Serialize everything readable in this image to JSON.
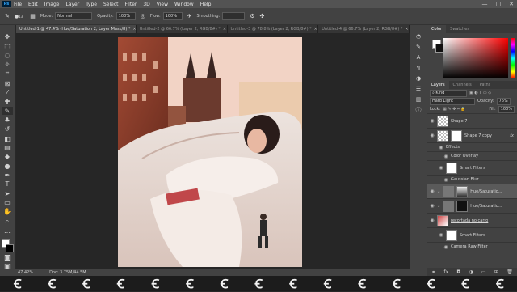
{
  "menu": {
    "logo": "Ps",
    "items": [
      "File",
      "Edit",
      "Image",
      "Layer",
      "Type",
      "Select",
      "Filter",
      "3D",
      "View",
      "Window",
      "Help"
    ],
    "window_buttons": [
      "—",
      "□",
      "✕"
    ]
  },
  "options": {
    "mode_label": "Mode:",
    "mode_value": "Normal",
    "opacity_label": "Opacity:",
    "opacity_value": "100%",
    "flow_label": "Flow:",
    "flow_value": "100%",
    "smoothing_label": "Smoothing:",
    "smoothing_value": "",
    "brush_size": "13"
  },
  "tabs": [
    {
      "label": "Untitled-1 @ 47.4% (Hue/Saturation 2, Layer Mask/8) *",
      "active": true
    },
    {
      "label": "Untitled-2 @ 66.7% (Layer 2, RGB/8#) *",
      "active": false
    },
    {
      "label": "Untitled-3 @ 78.8% (Layer 2, RGB/8#) *",
      "active": false
    },
    {
      "label": "Untitled-4 @ 66.7% (Layer 2, RGB/8#) *",
      "active": false
    }
  ],
  "status": {
    "zoom": "47.42%",
    "doc": "Doc: 3.75M/44.5M"
  },
  "color_panel": {
    "tabs": [
      "Color",
      "Swatches"
    ]
  },
  "layers_panel": {
    "tabs": [
      "Layers",
      "Channels",
      "Paths"
    ],
    "kind_label": "Kind",
    "blend_mode": "Hard Light",
    "opacity_label": "Opacity:",
    "opacity_value": "76%",
    "lock_label": "Lock:",
    "fill_label": "Fill:",
    "fill_value": "100%",
    "layers": [
      {
        "name": "Shape 7",
        "thumb": "chk",
        "fx": false,
        "kind": "layer"
      },
      {
        "name": "Shape 7 copy",
        "thumb": "chk",
        "fx": true,
        "kind": "layer"
      },
      {
        "name": "Effects",
        "kind": "sub"
      },
      {
        "name": "Color Overlay",
        "kind": "sub"
      },
      {
        "name": "Smart Filters",
        "thumb": "white",
        "kind": "layer-indent"
      },
      {
        "name": "Gaussian Blur",
        "kind": "sub"
      },
      {
        "name": "Hue/Saturatio...",
        "thumb": "grad",
        "fx": false,
        "kind": "layer",
        "selected": true
      },
      {
        "name": "Hue/Saturatio...",
        "thumb": "dark",
        "fx": false,
        "kind": "layer"
      },
      {
        "name": "recortada no carro",
        "thumb": "photo",
        "fx": false,
        "kind": "layer"
      },
      {
        "name": "Smart Filters",
        "thumb": "white",
        "kind": "layer-indent"
      },
      {
        "name": "Camera Raw Filter",
        "kind": "sub"
      }
    ]
  },
  "watermark": {
    "glyph": "Ꞓ",
    "count": 15
  }
}
